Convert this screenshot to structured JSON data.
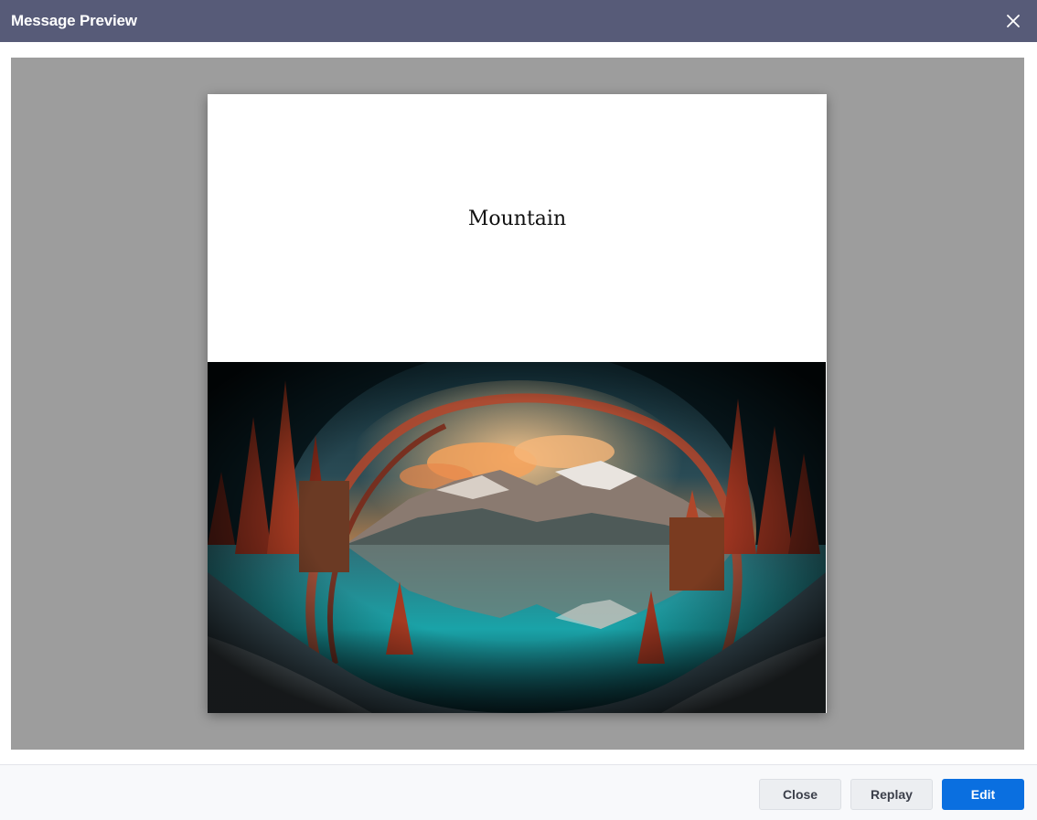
{
  "dialog": {
    "title": "Message Preview",
    "close_icon": "close-icon"
  },
  "preview": {
    "heading": "Mountain",
    "image_icon": "landscape-illustration"
  },
  "footer": {
    "close_label": "Close",
    "replay_label": "Replay",
    "edit_label": "Edit"
  },
  "colors": {
    "header_bg": "#575b78",
    "stage_bg": "#9d9d9d",
    "primary_button": "#0a6fe0"
  }
}
